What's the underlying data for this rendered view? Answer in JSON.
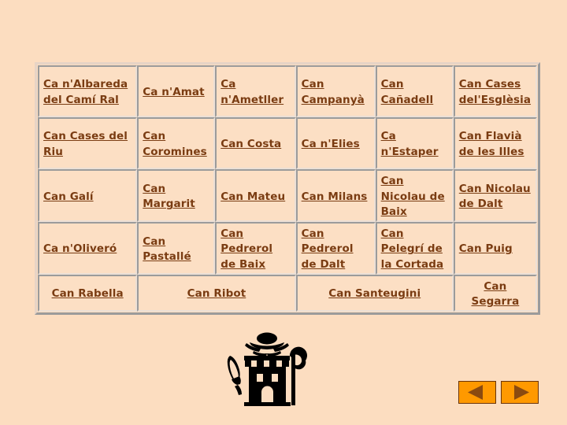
{
  "slide": {
    "background_color": "#fcddc0",
    "link_color": "#7a3c12"
  },
  "links_table": {
    "rows": [
      [
        "Ca n'Albareda del Camí Ral",
        "Ca n'Amat",
        "Ca n'Ametller",
        "Can Campanyà",
        "Can Cañadell",
        "Can Cases del'Esglèsia"
      ],
      [
        "Can Cases del Riu",
        "Can Coromines",
        "Can Costa",
        "Ca n'Elies",
        "Ca n'Estaper",
        "Can Flavià de les Illes"
      ],
      [
        "Can Galí",
        "Can Margarit",
        "Can Mateu",
        "Can Milans",
        "Can Nicolau de Baix",
        "Can Nicolau de Dalt"
      ],
      [
        "Ca n'Oliveró",
        "Can Pastallé",
        "Can Pedrerol de Baix",
        "Can Pedrerol de Dalt",
        "Can Pelegrí de la Cortada",
        "Can Puig"
      ]
    ],
    "last_row": [
      "Can Rabella",
      "Can Ribot",
      "Can Santeugini",
      "Can Segarra"
    ]
  },
  "emblem": {
    "name": "tower-hat-crook-emblem",
    "color": "#000000"
  },
  "nav": {
    "prev_label": "◀",
    "next_label": "▶",
    "button_color": "#ff9900",
    "arrow_color": "#8a4a10"
  }
}
